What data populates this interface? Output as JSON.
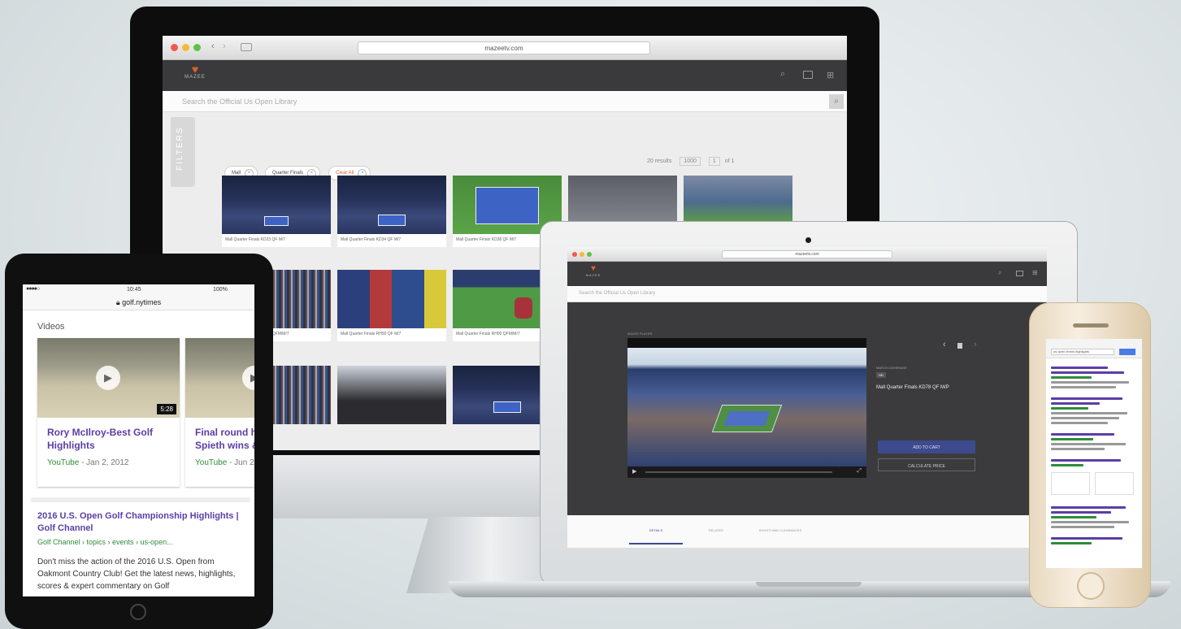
{
  "imac": {
    "url_text": "mazeetv.com",
    "search_placeholder": "Search the Official Us Open Library",
    "filters_tab": "FILTERS",
    "chips": [
      "Mall",
      "Quarter Finals",
      "Clear All"
    ],
    "pagination": {
      "results": "20 results",
      "per_page": "1000",
      "page": "1",
      "of": "of 1"
    },
    "row1": [
      "Mall Quarter Finals KD23 QF M/7",
      "Mall Quarter Finals KD34 QF M/7",
      "Mall Quarter Finals KD38 QF M/7",
      "",
      ""
    ],
    "row2": [
      "Mall Quarter Finals RH09 QFM/M/7",
      "Mall Quarter Finals RH90 QF M/7",
      "Mall Quarter Finals RH90 QFM/M/7"
    ],
    "row3": [
      "",
      "",
      ""
    ]
  },
  "laptop": {
    "url_text": "mazeetv.com",
    "search_placeholder": "Search the Official Us Open Library",
    "player_label": "MAZEE PLAYER",
    "category_label": "MATCH COVERAGE",
    "badge": "HD",
    "video_title": "Mall Quarter Finals KD78 QF M/P",
    "add_to_cart": "ADD TO CART",
    "calculate_price": "CALCULATE PRICE",
    "tabs": [
      "DETAILS",
      "RELATED",
      "RIGHTS AND CLEARANCES"
    ],
    "accent": "#3d4a8e"
  },
  "ipad": {
    "status_time": "10:45",
    "status_battery": "100%",
    "url_text": "golf.nytimes",
    "section_title": "Videos",
    "videos": [
      {
        "title": "Rory McIlroy-Best Golf Highlights",
        "source": "YouTube",
        "date": "- Jan 2, 2012",
        "duration": "5:28"
      },
      {
        "title": "Final round h U.S. Open G Spieth wins &",
        "source": "YouTube",
        "date": "- Jun 2",
        "duration": ""
      }
    ],
    "result": {
      "title": "2016 U.S. Open Golf Championship Highlights | Golf Channel",
      "url": "Golf Channel › topics › events › us-open...",
      "snippet": "Don't miss the action of the 2016 U.S. Open from Oakmont Country Club! Get the latest news, highlights, scores & expert commentary on Golf"
    }
  },
  "iphone": {
    "search_text": "us open tennis highlights"
  }
}
